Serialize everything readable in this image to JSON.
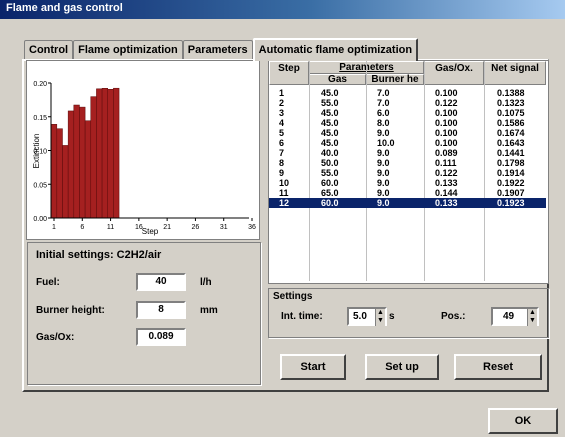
{
  "window": {
    "title": "Flame and gas control"
  },
  "tabs": [
    {
      "label": "Control"
    },
    {
      "label": "Flame optimization"
    },
    {
      "label": "Parameters"
    },
    {
      "label": "Automatic flame optimization"
    }
  ],
  "chart_data": {
    "type": "bar",
    "xlabel": "Step",
    "ylabel": "Extinction",
    "x": [
      1,
      2,
      3,
      4,
      5,
      6,
      7,
      8,
      9,
      10,
      11,
      12
    ],
    "values": [
      0.1388,
      0.1323,
      0.1075,
      0.1586,
      0.1674,
      0.1643,
      0.1441,
      0.1798,
      0.1914,
      0.1922,
      0.1907,
      0.1923
    ],
    "ylim": [
      0.0,
      0.2
    ],
    "xlim": [
      1,
      36
    ],
    "yticks": [
      "0.20",
      "0.15",
      "0.10",
      "0.05",
      "0.00"
    ],
    "xticks": [
      "1",
      "6",
      "11",
      "16",
      "21",
      "26",
      "31",
      "36"
    ],
    "bar_color": "#a52020",
    "grid": false
  },
  "initial_settings": {
    "title": "Initial settings: C2H2/air",
    "fuel_label": "Fuel:",
    "fuel_value": "40",
    "fuel_unit": "l/h",
    "burner_label": "Burner height:",
    "burner_value": "8",
    "burner_unit": "mm",
    "gas_label": "Gas/Ox:",
    "gas_value": "0.089"
  },
  "table": {
    "headers": {
      "step": "Step",
      "parameters": "Parameters",
      "gas": "Gas",
      "burner": "Burner he",
      "gasox": "Gas/Ox.",
      "net": "Net signal"
    },
    "selected_index": 11,
    "rows": [
      {
        "step": "1",
        "gas": "45.0",
        "burner": "7.0",
        "gasox": "0.100",
        "net": "0.1388"
      },
      {
        "step": "2",
        "gas": "55.0",
        "burner": "7.0",
        "gasox": "0.122",
        "net": "0.1323"
      },
      {
        "step": "3",
        "gas": "45.0",
        "burner": "6.0",
        "gasox": "0.100",
        "net": "0.1075"
      },
      {
        "step": "4",
        "gas": "45.0",
        "burner": "8.0",
        "gasox": "0.100",
        "net": "0.1586"
      },
      {
        "step": "5",
        "gas": "45.0",
        "burner": "9.0",
        "gasox": "0.100",
        "net": "0.1674"
      },
      {
        "step": "6",
        "gas": "45.0",
        "burner": "10.0",
        "gasox": "0.100",
        "net": "0.1643"
      },
      {
        "step": "7",
        "gas": "40.0",
        "burner": "9.0",
        "gasox": "0.089",
        "net": "0.1441"
      },
      {
        "step": "8",
        "gas": "50.0",
        "burner": "9.0",
        "gasox": "0.111",
        "net": "0.1798"
      },
      {
        "step": "9",
        "gas": "55.0",
        "burner": "9.0",
        "gasox": "0.122",
        "net": "0.1914"
      },
      {
        "step": "10",
        "gas": "60.0",
        "burner": "9.0",
        "gasox": "0.133",
        "net": "0.1922"
      },
      {
        "step": "11",
        "gas": "65.0",
        "burner": "9.0",
        "gasox": "0.144",
        "net": "0.1907"
      },
      {
        "step": "12",
        "gas": "60.0",
        "burner": "9.0",
        "gasox": "0.133",
        "net": "0.1923"
      }
    ]
  },
  "settings": {
    "title": "Settings",
    "int_time_label": "Int. time:",
    "int_time_value": "5.0",
    "int_time_unit": "s",
    "pos_label": "Pos.:",
    "pos_value": "49"
  },
  "buttons": {
    "start": "Start",
    "setup": "Set up",
    "reset": "Reset",
    "ok": "OK"
  }
}
